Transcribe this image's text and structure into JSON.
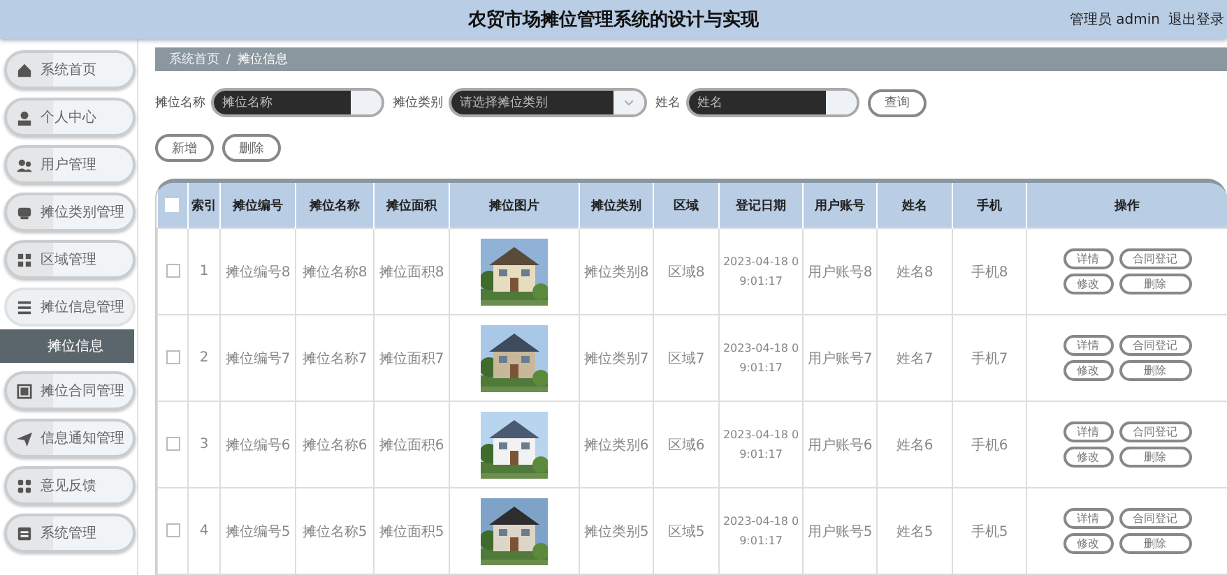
{
  "header": {
    "title": "农贸市场摊位管理系统的设计与实现",
    "user": "管理员 admin",
    "logout": "退出登录"
  },
  "sidebar": {
    "items": [
      {
        "label": "系统首页",
        "expanded": false
      },
      {
        "label": "个人中心",
        "expanded": false
      },
      {
        "label": "用户管理",
        "expanded": false
      },
      {
        "label": "摊位类别管理",
        "expanded": false
      },
      {
        "label": "区域管理",
        "expanded": false
      },
      {
        "label": "摊位信息管理",
        "expanded": true,
        "children": [
          {
            "label": "摊位信息",
            "selected": true
          }
        ]
      },
      {
        "label": "摊位合同管理",
        "expanded": false
      },
      {
        "label": "信息通知管理",
        "expanded": false
      },
      {
        "label": "意见反馈",
        "expanded": false
      },
      {
        "label": "系统管理",
        "expanded": false
      }
    ]
  },
  "breadcrumb": {
    "items": [
      "系统首页",
      "摊位信息"
    ],
    "separator": "/"
  },
  "search": {
    "fields": [
      {
        "label": "摊位名称",
        "placeholder": "摊位名称",
        "kind": "input"
      },
      {
        "label": "摊位类别",
        "placeholder": "请选择摊位类别",
        "kind": "select"
      },
      {
        "label": "姓名",
        "placeholder": "姓名",
        "kind": "input"
      }
    ],
    "button": "查询"
  },
  "actions": [
    "新增",
    "删除"
  ],
  "table": {
    "select_all": false,
    "columns": [
      "索引",
      "摊位编号",
      "摊位名称",
      "摊位面积",
      "摊位图片",
      "摊位类别",
      "区域",
      "登记日期",
      "用户账号",
      "姓名",
      "手机",
      "操作"
    ],
    "rows": [
      {
        "checked": false,
        "cells": [
          "1",
          "摊位编号8",
          "摊位名称8",
          "摊位面积8",
          {
            "kind": "picture"
          },
          "摊位类别8",
          "区域8",
          "2023-04-18 09:01:17",
          "用户账号8",
          "姓名8",
          "手机8"
        ],
        "actions": [
          "详情",
          "合同登记",
          "修改",
          "删除"
        ]
      },
      {
        "checked": false,
        "cells": [
          "2",
          "摊位编号7",
          "摊位名称7",
          "摊位面积7",
          {
            "kind": "picture"
          },
          "摊位类别7",
          "区域7",
          "2023-04-18 09:01:17",
          "用户账号7",
          "姓名7",
          "手机7"
        ],
        "actions": [
          "详情",
          "合同登记",
          "修改",
          "删除"
        ]
      },
      {
        "checked": false,
        "cells": [
          "3",
          "摊位编号6",
          "摊位名称6",
          "摊位面积6",
          {
            "kind": "picture"
          },
          "摊位类别6",
          "区域6",
          "2023-04-18 09:01:17",
          "用户账号6",
          "姓名6",
          "手机6"
        ],
        "actions": [
          "详情",
          "合同登记",
          "修改",
          "删除"
        ]
      },
      {
        "checked": false,
        "cells": [
          "4",
          "摊位编号5",
          "摊位名称5",
          "摊位面积5",
          {
            "kind": "picture"
          },
          "摊位类别5",
          "区域5",
          "2023-04-18 09:01:17",
          "用户账号5",
          "姓名5",
          "手机5"
        ],
        "actions": [
          "详情",
          "合同登记",
          "修改",
          "删除"
        ]
      }
    ]
  }
}
